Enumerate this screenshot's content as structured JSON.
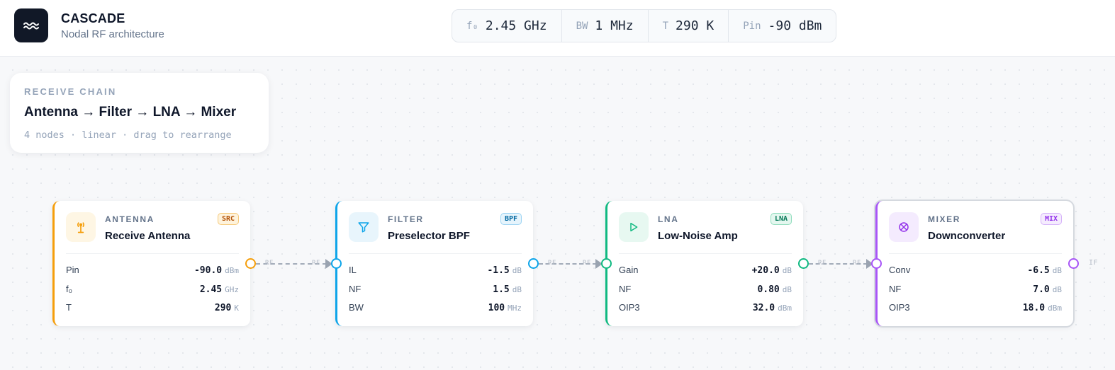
{
  "app": {
    "title": "CASCADE",
    "subtitle": "Nodal RF architecture",
    "logo_icon": "wave-icon"
  },
  "params": [
    {
      "key": "f₀",
      "value": "2.45 GHz"
    },
    {
      "key": "BW",
      "value": "1 MHz"
    },
    {
      "key": "T",
      "value": "290 K"
    },
    {
      "key": "Pin",
      "value": "-90 dBm"
    }
  ],
  "info": {
    "eyebrow": "RECEIVE CHAIN",
    "title": "Antenna → Filter → LNA → Mixer",
    "meta": "4 nodes · linear · drag to rearrange"
  },
  "nodes": [
    {
      "category": "ANTENNA",
      "name": "Receive Antenna",
      "badge": "SRC",
      "icon": "antenna-icon",
      "color": "#f59e0b",
      "rows": [
        {
          "label": "Pin",
          "value": "-90.0",
          "unit": "dBm"
        },
        {
          "label": "f₀",
          "value": "2.45",
          "unit": "GHz"
        },
        {
          "label": "T",
          "value": "290",
          "unit": "K"
        }
      ]
    },
    {
      "category": "FILTER",
      "name": "Preselector BPF",
      "badge": "BPF",
      "icon": "filter-icon",
      "color": "#0ea5e9",
      "rows": [
        {
          "label": "IL",
          "value": "-1.5",
          "unit": "dB"
        },
        {
          "label": "NF",
          "value": "1.5",
          "unit": "dB"
        },
        {
          "label": "BW",
          "value": "100",
          "unit": "MHz"
        }
      ]
    },
    {
      "category": "LNA",
      "name": "Low-Noise Amp",
      "badge": "LNA",
      "icon": "amplifier-icon",
      "color": "#10b981",
      "rows": [
        {
          "label": "Gain",
          "value": "+20.0",
          "unit": "dB"
        },
        {
          "label": "NF",
          "value": "0.80",
          "unit": "dB"
        },
        {
          "label": "OIP3",
          "value": "32.0",
          "unit": "dBm"
        }
      ]
    },
    {
      "category": "MIXER",
      "name": "Downconverter",
      "badge": "MIX",
      "icon": "mixer-icon",
      "color": "#a855f7",
      "rows": [
        {
          "label": "Conv",
          "value": "-6.5",
          "unit": "dB"
        },
        {
          "label": "NF",
          "value": "7.0",
          "unit": "dB"
        },
        {
          "label": "OIP3",
          "value": "18.0",
          "unit": "dBm"
        }
      ]
    }
  ],
  "wire_label": "RF",
  "output_label": "IF"
}
